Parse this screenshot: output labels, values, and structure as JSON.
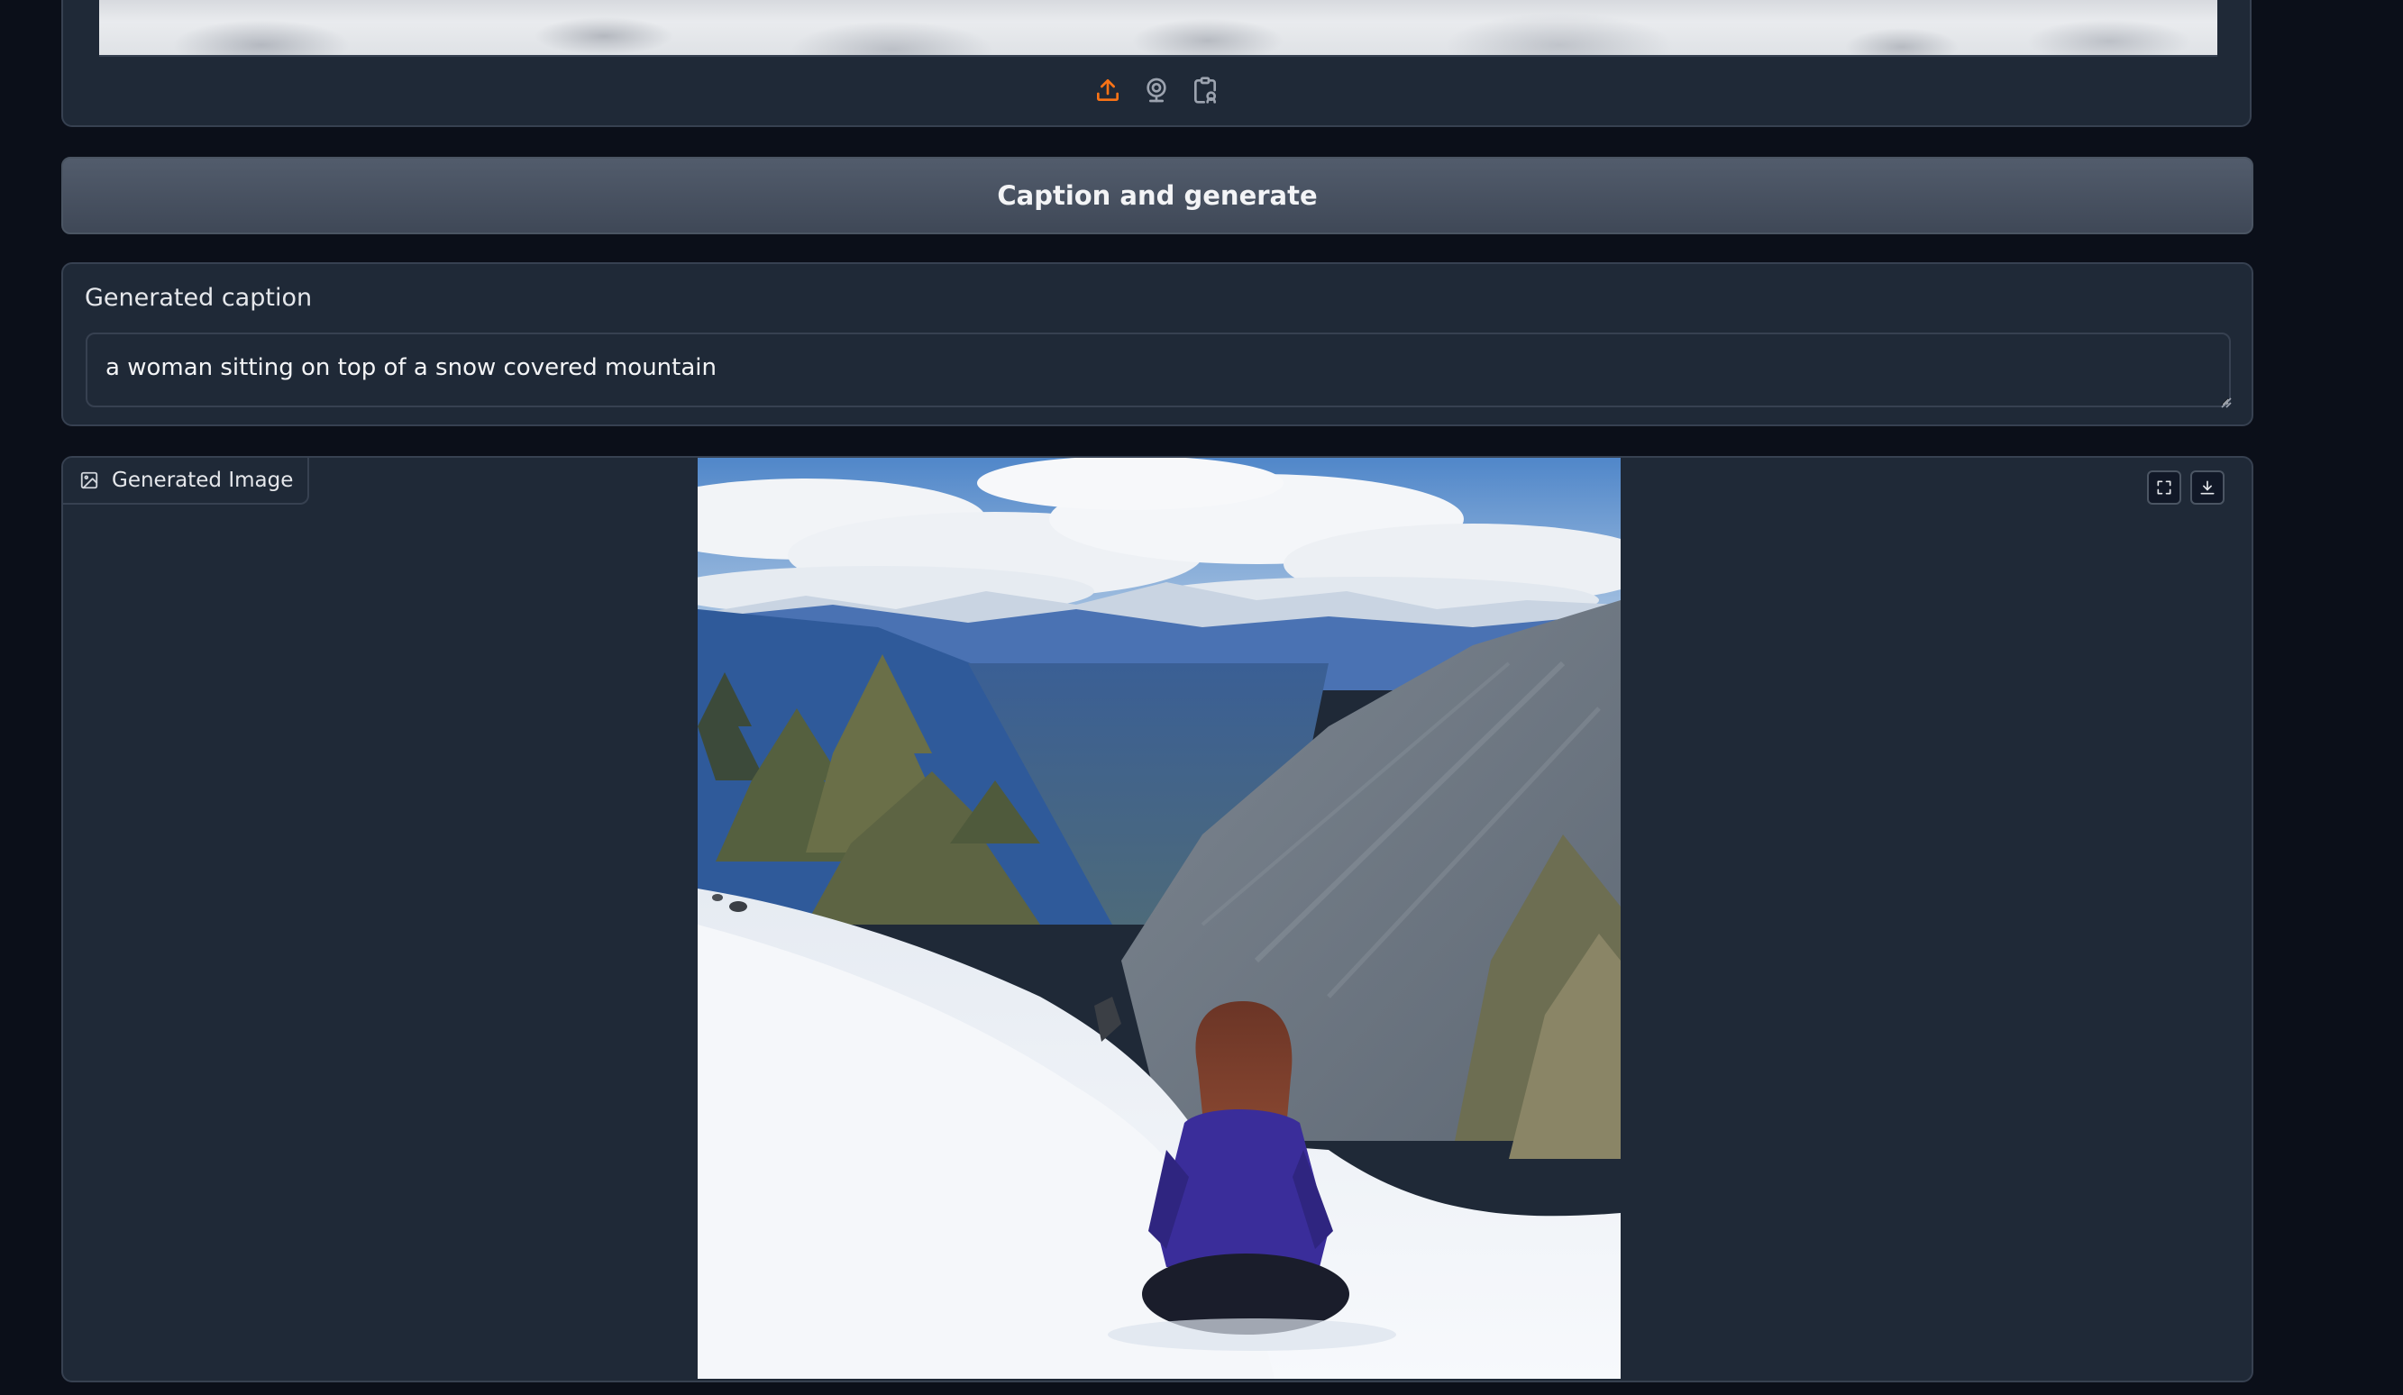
{
  "input_panel": {
    "source_icons": [
      "upload-icon",
      "webcam-icon",
      "clipboard-icon"
    ]
  },
  "generate_button": {
    "label": "Caption and generate"
  },
  "caption": {
    "label": "Generated caption",
    "value": "a woman sitting on top of a snow covered mountain"
  },
  "output": {
    "label": "Generated Image",
    "actions": [
      "fullscreen-icon",
      "download-icon"
    ]
  },
  "colors": {
    "background": "#0b0f19",
    "panel": "#1f2937",
    "border": "#374151",
    "accent": "#f97316",
    "button": "#4b5563"
  }
}
